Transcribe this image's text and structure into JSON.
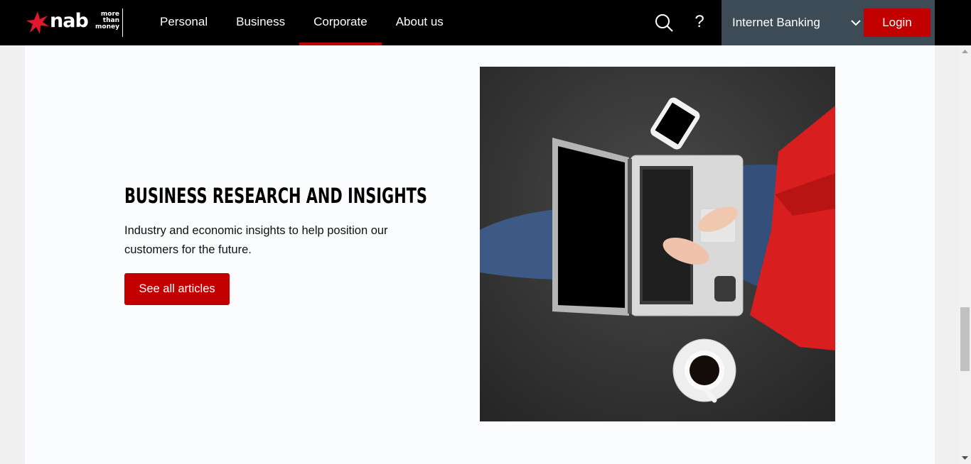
{
  "header": {
    "logo_word": "nab",
    "logo_tagline": [
      "more",
      "than",
      "money"
    ],
    "nav": [
      {
        "label": "Personal"
      },
      {
        "label": "Business"
      },
      {
        "label": "Corporate",
        "active": true
      },
      {
        "label": "About us"
      }
    ],
    "help_label": "?",
    "internet_banking_label": "Internet Banking",
    "login_label": "Login"
  },
  "main": {
    "heading": "BUSINESS RESEARCH AND INSIGHTS",
    "description": "Industry and economic insights to help position our customers for the future.",
    "cta_label": "See all articles"
  },
  "icons": {
    "logo": "nab-star-icon",
    "search": "search-icon",
    "help": "help-icon",
    "chevron": "chevron-down-icon"
  },
  "colors": {
    "brand_red": "#c20000",
    "header_bg": "#000000",
    "ib_panel_bg": "#3c4b55"
  }
}
